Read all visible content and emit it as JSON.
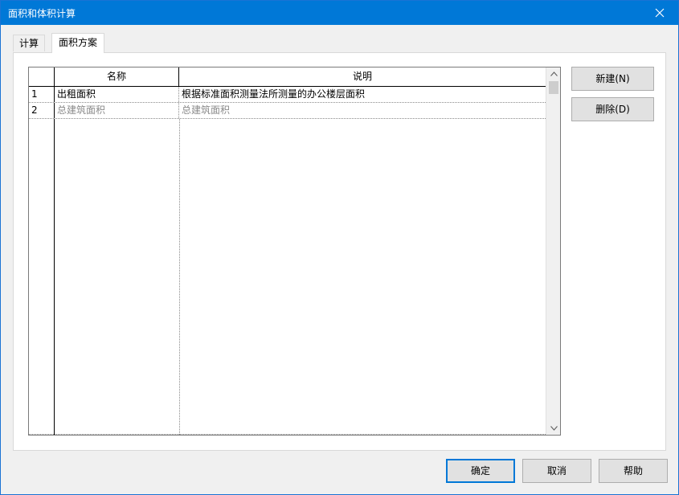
{
  "window": {
    "title": "面积和体积计算",
    "close_icon": "close-icon"
  },
  "tabs": [
    {
      "label": "计算",
      "active": false
    },
    {
      "label": "面积方案",
      "active": true
    }
  ],
  "grid": {
    "columns": [
      "名称",
      "说明"
    ],
    "rows": [
      {
        "num": "1",
        "name": "出租面积",
        "desc": "根据标准面积测量法所测量的办公楼层面积"
      },
      {
        "num": "2",
        "name": "总建筑面积",
        "desc": "总建筑面积"
      }
    ]
  },
  "side_buttons": {
    "new_label": "新建(N)",
    "delete_label": "删除(D)"
  },
  "footer_buttons": {
    "ok_label": "确定",
    "cancel_label": "取消",
    "help_label": "帮助"
  },
  "colors": {
    "titlebar": "#0078d7",
    "dialog_bg": "#f0f0f0",
    "button_bg": "#e1e1e1",
    "default_button_border": "#0078d7",
    "inactive_row_text": "#8a8a8a"
  }
}
